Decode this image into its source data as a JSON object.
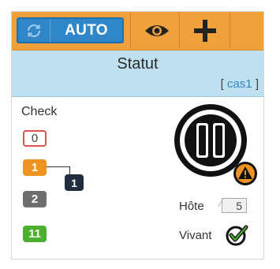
{
  "toolbar": {
    "auto_label": "AUTO",
    "accent": "#f0a03c"
  },
  "status": {
    "title": "Statut",
    "instance_open": "[ ",
    "instance_name": "cas1",
    "instance_close": " ]"
  },
  "checks": {
    "label": "Check",
    "pending": "0",
    "warning": "1",
    "acknowledged": "1",
    "critical": "2",
    "ok": "11"
  },
  "host": {
    "label": "Hôte",
    "count": "5",
    "alive_label": "Vivant"
  },
  "colors": {
    "warning": "#ee9322",
    "critical": "#6e6e6e",
    "ok": "#4caf2e",
    "pending_border": "#e05252",
    "acknowledged": "#1f2d3d",
    "auto_button": "#2f86c8"
  }
}
